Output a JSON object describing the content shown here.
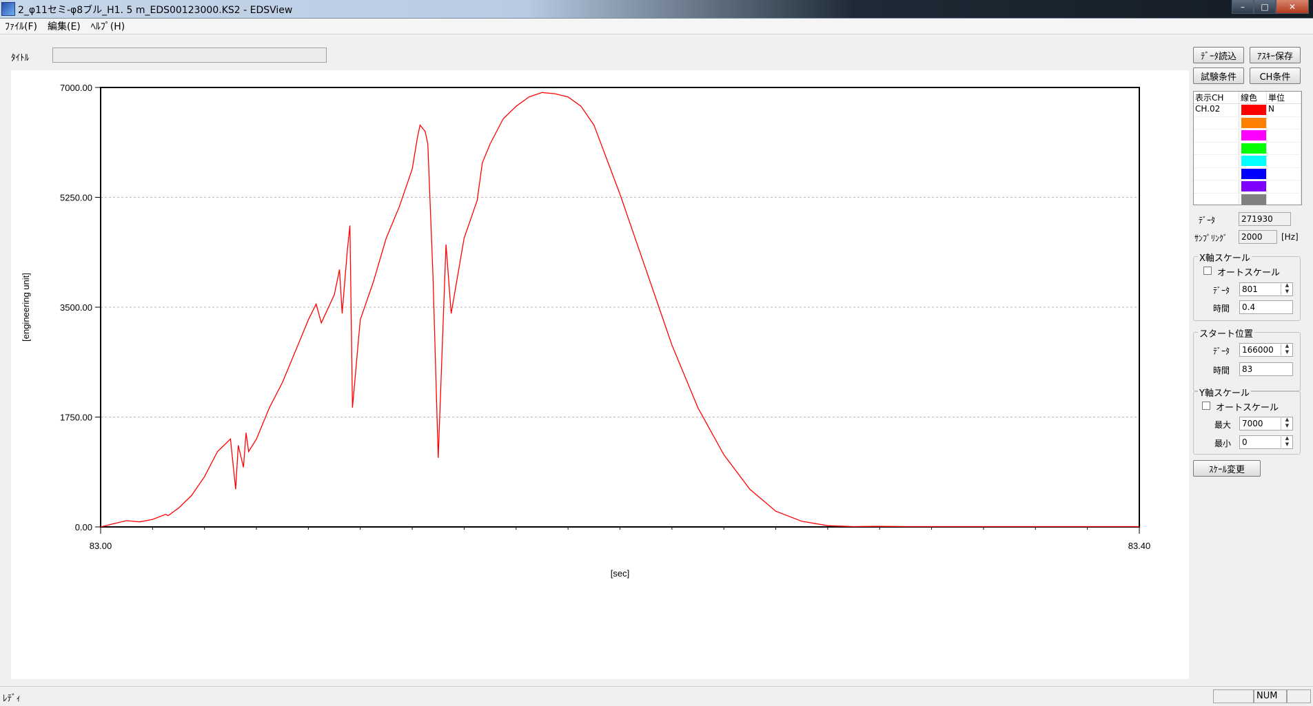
{
  "window": {
    "title": "2_φ11セミ-φ8ブル_H1. 5 m_EDS00123000.KS2 - EDSView"
  },
  "menu": [
    "ﾌｧｲﾙ(F)",
    "編集(E)",
    "ﾍﾙﾌﾟ(H)"
  ],
  "title_field": {
    "label": "ﾀｲﾄﾙ",
    "value": ""
  },
  "side": {
    "buttons": {
      "load": "ﾃﾞｰﾀ読込",
      "ascii_save": "ｱｽｷｰ保存",
      "test_cond": "試験条件",
      "ch_cond": "CH条件"
    },
    "table": {
      "headers": [
        "表示CH",
        "線色",
        "単位"
      ],
      "rows": [
        {
          "ch": "CH.02",
          "color": "#ff0000",
          "unit": "N"
        },
        {
          "ch": "",
          "color": "#ff8000",
          "unit": ""
        },
        {
          "ch": "",
          "color": "#ff00ff",
          "unit": ""
        },
        {
          "ch": "",
          "color": "#00ff00",
          "unit": ""
        },
        {
          "ch": "",
          "color": "#00ffff",
          "unit": ""
        },
        {
          "ch": "",
          "color": "#0000ff",
          "unit": ""
        },
        {
          "ch": "",
          "color": "#8000ff",
          "unit": ""
        },
        {
          "ch": "",
          "color": "#808080",
          "unit": ""
        }
      ]
    },
    "data_label": "ﾃﾞｰﾀ",
    "data_count": "271930",
    "sampling_label": "ｻﾝﾌﾟﾘﾝｸﾞ",
    "sampling_value": "2000",
    "sampling_unit": "[Hz]",
    "x_scale": {
      "title": "X軸スケール",
      "auto_label": "オートスケール",
      "data_label": "ﾃﾞｰﾀ",
      "data_value": "801",
      "time_label": "時間",
      "time_value": "0.4"
    },
    "start": {
      "title": "スタート位置",
      "data_label": "ﾃﾞｰﾀ",
      "data_value": "166000",
      "time_label": "時間",
      "time_value": "83"
    },
    "y_scale": {
      "title": "Y軸スケール",
      "auto_label": "オートスケール",
      "max_label": "最大",
      "max_value": "7000",
      "min_label": "最小",
      "min_value": "0"
    },
    "scale_change": "ｽｹｰﾙ変更"
  },
  "status": {
    "text": "ﾚﾃﾞｨ",
    "num": "NUM"
  },
  "chart_data": {
    "type": "line",
    "xlabel": "[sec]",
    "ylabel": "[engineering unit]",
    "xlim": [
      83.0,
      83.4
    ],
    "ylim": [
      0,
      7000
    ],
    "x_tick_labels": [
      "83.00",
      "83.40"
    ],
    "y_tick_labels": [
      "0.00",
      "1750.00",
      "3500.00",
      "5250.00",
      "7000.00"
    ],
    "grid": "horizontal-dashed",
    "series": [
      {
        "color": "#ff0000",
        "x": [
          83.0,
          83.005,
          83.01,
          83.015,
          83.02,
          83.025,
          83.026,
          83.03,
          83.035,
          83.04,
          83.045,
          83.05,
          83.052,
          83.053,
          83.055,
          83.056,
          83.057,
          83.06,
          83.065,
          83.07,
          83.072,
          83.075,
          83.078,
          83.08,
          83.083,
          83.085,
          83.09,
          83.092,
          83.093,
          83.095,
          83.096,
          83.097,
          83.1,
          83.105,
          83.11,
          83.115,
          83.12,
          83.122,
          83.123,
          83.125,
          83.126,
          83.128,
          83.13,
          83.133,
          83.135,
          83.14,
          83.145,
          83.147,
          83.15,
          83.155,
          83.16,
          83.165,
          83.17,
          83.175,
          83.18,
          83.185,
          83.19,
          83.2,
          83.205,
          83.21,
          83.215,
          83.22,
          83.23,
          83.24,
          83.25,
          83.26,
          83.27,
          83.28,
          83.29,
          83.3,
          83.31,
          83.32,
          83.33,
          83.34,
          83.35,
          83.36,
          83.37,
          83.38,
          83.39,
          83.4
        ],
        "y": [
          0,
          50,
          100,
          80,
          120,
          200,
          180,
          300,
          500,
          800,
          1200,
          1400,
          600,
          1300,
          950,
          1500,
          1200,
          1400,
          1900,
          2300,
          2500,
          2800,
          3100,
          3300,
          3550,
          3250,
          3700,
          4100,
          3400,
          4400,
          4800,
          1900,
          3300,
          3900,
          4600,
          5100,
          5700,
          6200,
          6400,
          6300,
          6100,
          4000,
          1100,
          4500,
          3400,
          4600,
          5200,
          5800,
          6100,
          6500,
          6700,
          6850,
          6920,
          6900,
          6850,
          6700,
          6400,
          5300,
          4700,
          4100,
          3500,
          2900,
          1900,
          1150,
          600,
          250,
          90,
          20,
          5,
          10,
          5,
          5,
          5,
          5,
          5,
          5,
          5,
          5,
          5,
          5
        ]
      }
    ]
  }
}
